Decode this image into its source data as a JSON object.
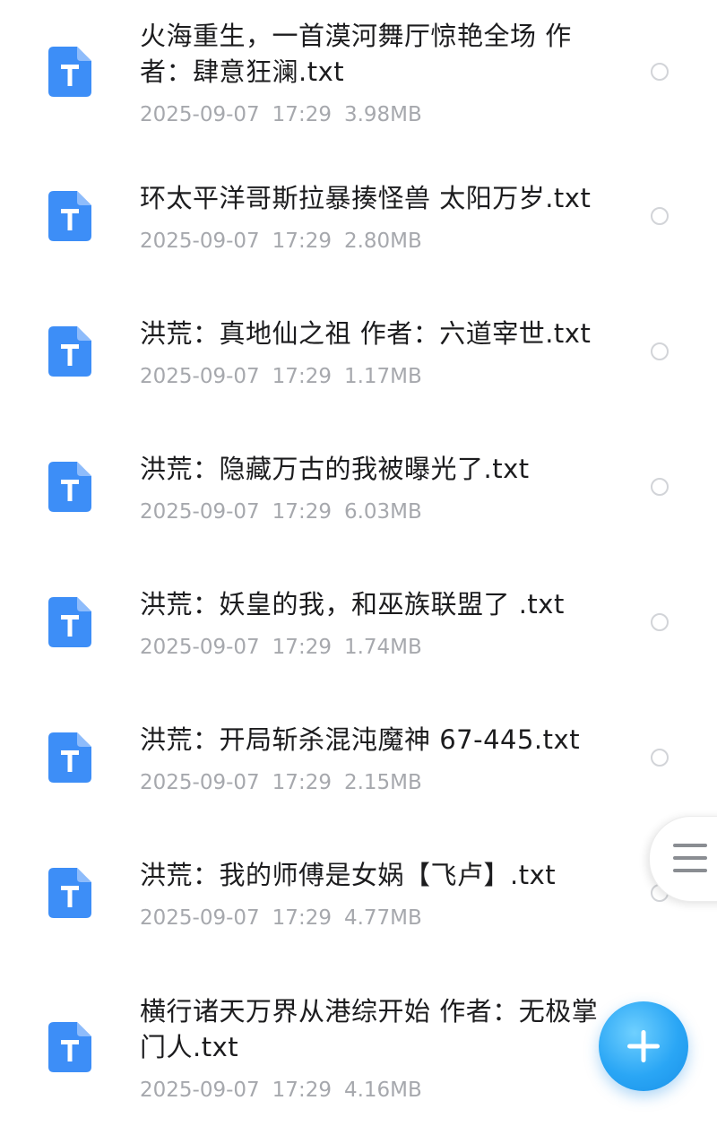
{
  "files": [
    {
      "name": "火海重生，一首漠河舞厅惊艳全场 作者：肆意狂澜.txt",
      "date": "2025-09-07",
      "time": "17:29",
      "size": "3.98MB"
    },
    {
      "name": "环太平洋哥斯拉暴揍怪兽 太阳万岁.txt",
      "date": "2025-09-07",
      "time": "17:29",
      "size": "2.80MB"
    },
    {
      "name": "洪荒：真地仙之祖 作者：六道宰世.txt",
      "date": "2025-09-07",
      "time": "17:29",
      "size": "1.17MB"
    },
    {
      "name": "洪荒：隐藏万古的我被曝光了.txt",
      "date": "2025-09-07",
      "time": "17:29",
      "size": "6.03MB"
    },
    {
      "name": "洪荒：妖皇的我，和巫族联盟了 .txt",
      "date": "2025-09-07",
      "time": "17:29",
      "size": "1.74MB"
    },
    {
      "name": "洪荒：开局斩杀混沌魔神 67-445.txt",
      "date": "2025-09-07",
      "time": "17:29",
      "size": "2.15MB"
    },
    {
      "name": "洪荒：我的师傅是女娲【飞卢】.txt",
      "date": "2025-09-07",
      "time": "17:29",
      "size": "4.77MB"
    },
    {
      "name": "横行诸天万界从港综开始 作者：无极掌门人.txt",
      "date": "2025-09-07",
      "time": "17:29",
      "size": "4.16MB"
    }
  ],
  "icons": {
    "file_type": "txt-file-icon",
    "file_letter": "T",
    "side_menu": "menu-icon",
    "add": "plus-icon"
  },
  "colors": {
    "file_icon": "#3d8ef7",
    "meta_text": "#a6a8ad",
    "fab": "#2aa6f5"
  }
}
